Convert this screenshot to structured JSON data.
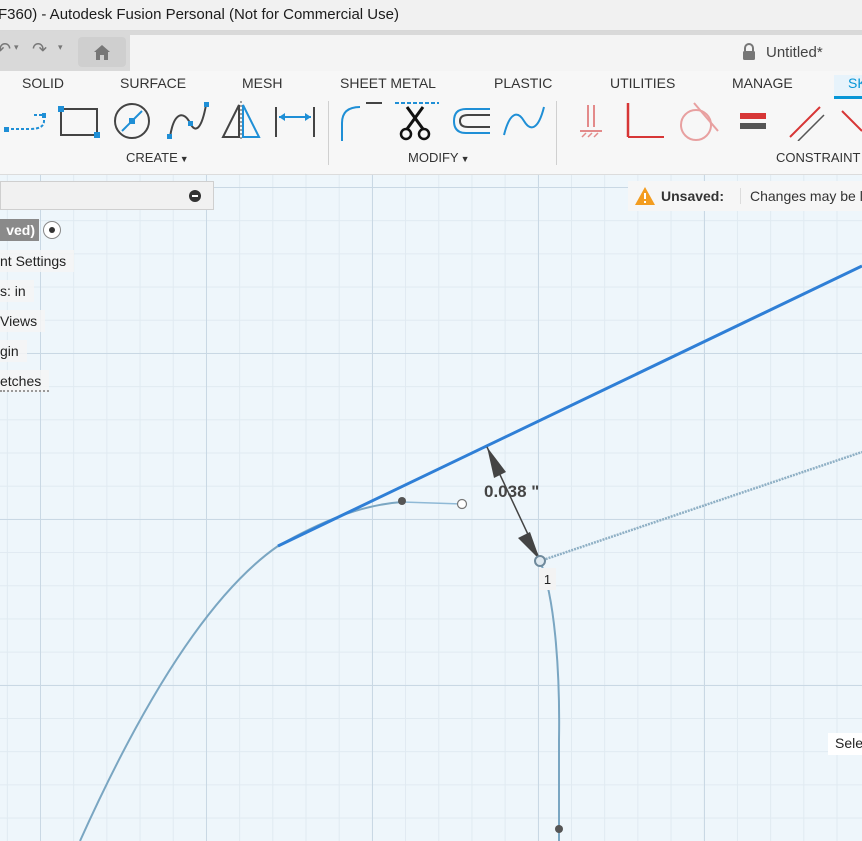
{
  "window": {
    "title": "F360) - Autodesk Fusion Personal (Not for Commercial Use)"
  },
  "document": {
    "title": "Untitled*"
  },
  "toolbar": {
    "tabs": [
      {
        "label": "SOLID"
      },
      {
        "label": "SURFACE"
      },
      {
        "label": "MESH"
      },
      {
        "label": "SHEET METAL"
      },
      {
        "label": "PLASTIC"
      },
      {
        "label": "UTILITIES"
      },
      {
        "label": "MANAGE"
      },
      {
        "label": "SK"
      }
    ],
    "groups": {
      "create": "CREATE",
      "modify": "MODIFY",
      "constraints": "CONSTRAINT"
    }
  },
  "browser": {
    "unsaved_tag": "ved)",
    "items": [
      "nt Settings",
      "s: in",
      "Views",
      "gin",
      "etches"
    ]
  },
  "notification": {
    "label": "Unsaved:",
    "message": "Changes may be lo"
  },
  "sketch": {
    "dimension": "0.038 \"",
    "point_label": "1",
    "hint": "Sele"
  },
  "colors": {
    "accent": "#0696d7",
    "selected_line": "#2f7fd6",
    "sketch_curve": "#7aa6c2",
    "warning": "#f39c1f"
  }
}
